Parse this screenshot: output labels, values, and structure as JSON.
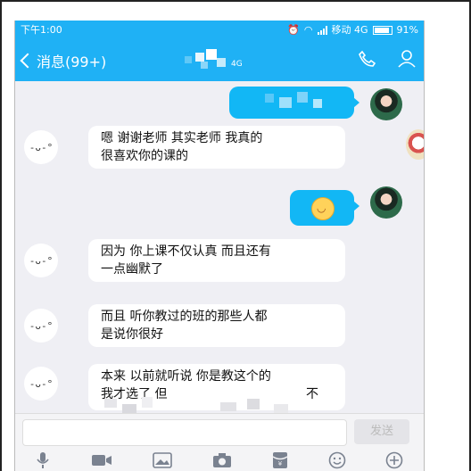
{
  "status_bar": {
    "time": "下午1:00",
    "carrier": "移动 4G",
    "battery": "91%"
  },
  "nav": {
    "back_label": "消息(99+)",
    "title_suffix": "4G"
  },
  "messages": [
    {
      "side": "right",
      "kind": "text-redacted"
    },
    {
      "side": "left",
      "text_line1": "嗯 谢谢老师 其实老师 我真的",
      "text_line2": "很喜欢你的课的"
    },
    {
      "side": "right",
      "kind": "emoji"
    },
    {
      "side": "left",
      "text_line1": "因为 你上课不仅认真 而且还有",
      "text_line2": "一点幽默了"
    },
    {
      "side": "left",
      "text_line1": "而且 听你教过的班的那些人都",
      "text_line2": "是说你很好"
    },
    {
      "side": "left",
      "text_line1": "本来 以前就听说 你是教这个的",
      "text_line2": "我才选了 但",
      "text_line3": "不"
    }
  ],
  "avatar_face": "-ᴗ-°",
  "input": {
    "send_label": "发送"
  },
  "icons": [
    "mic-icon",
    "video-icon",
    "image-icon",
    "camera-icon",
    "red-packet-icon",
    "emoji-icon",
    "plus-icon"
  ],
  "colors": {
    "header": "#1fb1f5",
    "bubble_right": "#12b7f5",
    "bubble_left": "#ffffff",
    "chat_bg": "#efeff4"
  }
}
